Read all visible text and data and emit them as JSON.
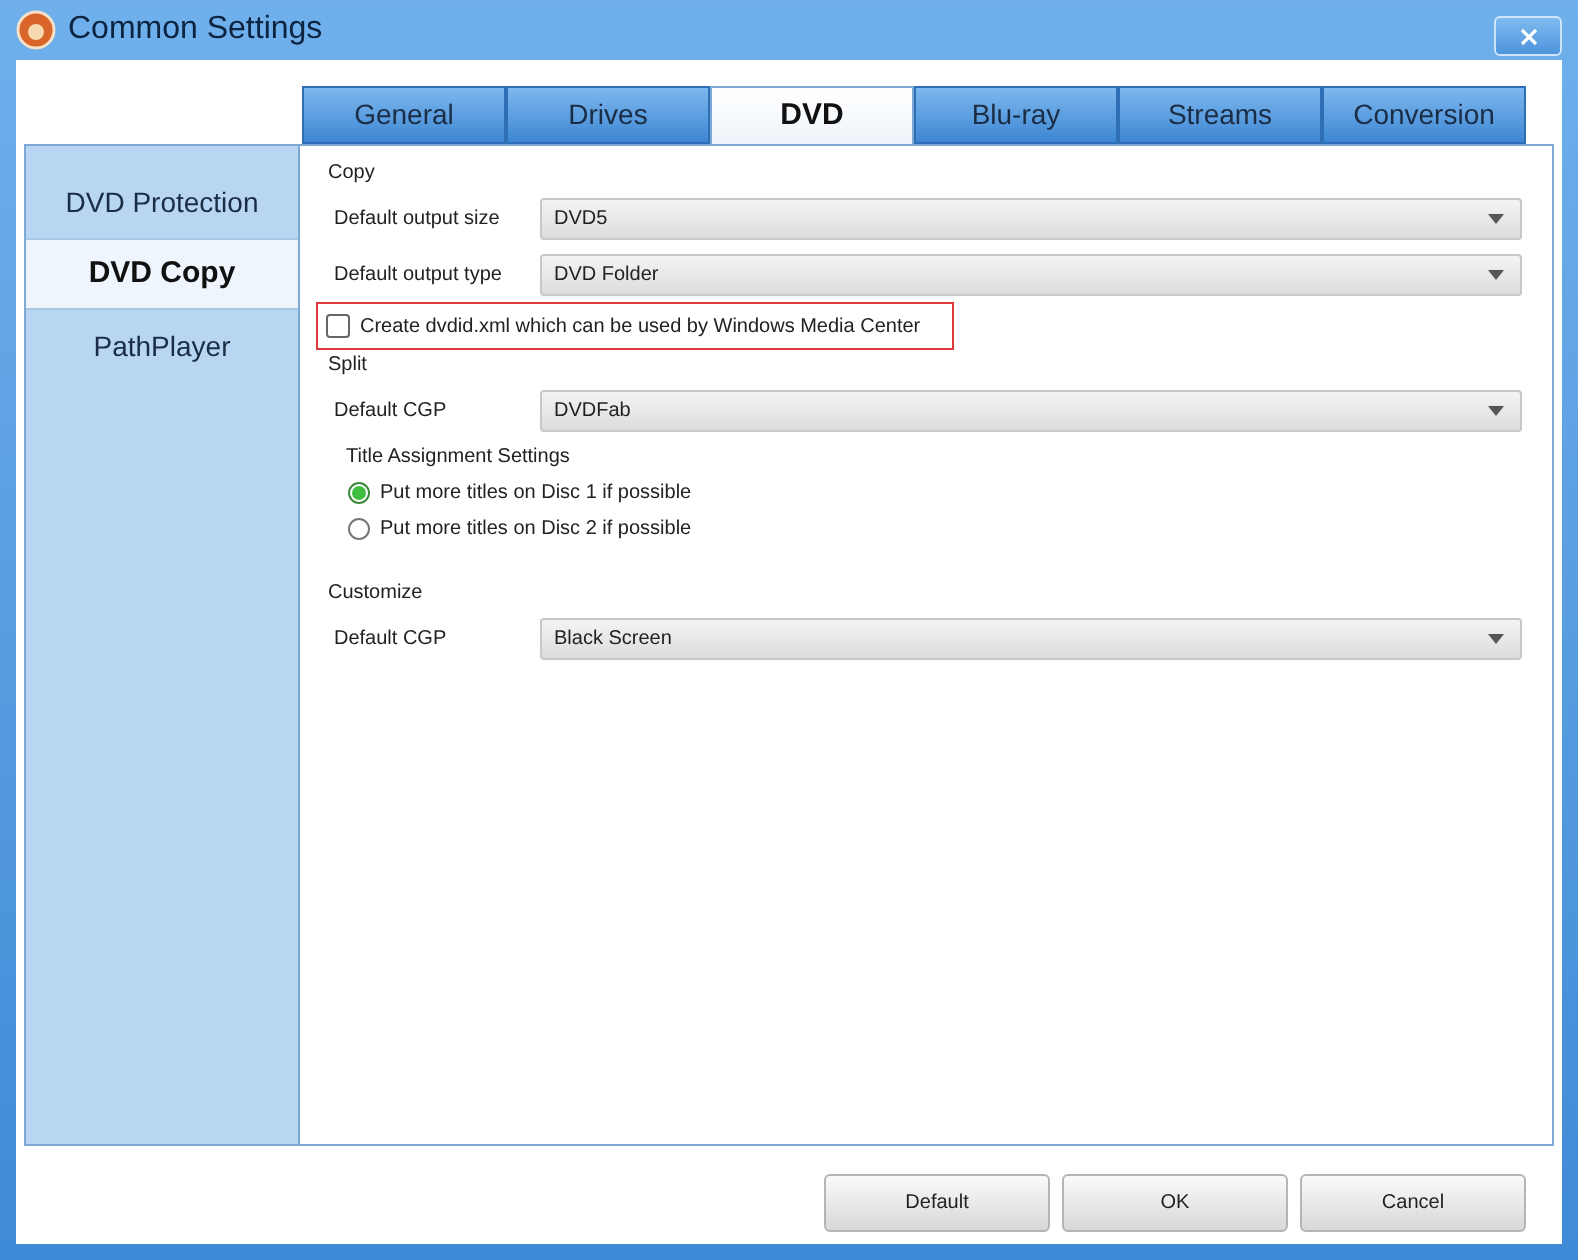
{
  "window": {
    "title": "Common Settings"
  },
  "tabs": [
    {
      "label": "General",
      "selected": false
    },
    {
      "label": "Drives",
      "selected": false
    },
    {
      "label": "DVD",
      "selected": true
    },
    {
      "label": "Blu-ray",
      "selected": false
    },
    {
      "label": "Streams",
      "selected": false
    },
    {
      "label": "Conversion",
      "selected": false
    }
  ],
  "sidebar": {
    "items": [
      {
        "label": "DVD Protection",
        "selected": false
      },
      {
        "label": "DVD Copy",
        "selected": true
      },
      {
        "label": "PathPlayer",
        "selected": false
      }
    ]
  },
  "sections": [
    {
      "title": "Copy",
      "rows": [
        {
          "kind": "select",
          "label": "Default output size",
          "value": "DVD5"
        },
        {
          "kind": "select",
          "label": "Default output type",
          "value": "DVD Folder"
        },
        {
          "kind": "checkbox",
          "label": "Create dvdid.xml which can be used by Windows Media Center",
          "checked": false,
          "highlighted": true
        }
      ]
    },
    {
      "title": "Split",
      "rows": [
        {
          "kind": "select",
          "label": "Default CGP",
          "value": "DVDFab"
        },
        {
          "kind": "subheading",
          "label": "Title Assignment Settings"
        },
        {
          "kind": "radio",
          "label": "Put more titles on Disc 1 if possible",
          "selected": true
        },
        {
          "kind": "radio",
          "label": "Put more titles on Disc 2 if possible",
          "selected": false
        }
      ]
    },
    {
      "title": "Customize",
      "rows": [
        {
          "kind": "select",
          "label": "Default CGP",
          "value": "Black Screen"
        }
      ]
    }
  ],
  "buttons": [
    "Default",
    "OK",
    "Cancel"
  ]
}
